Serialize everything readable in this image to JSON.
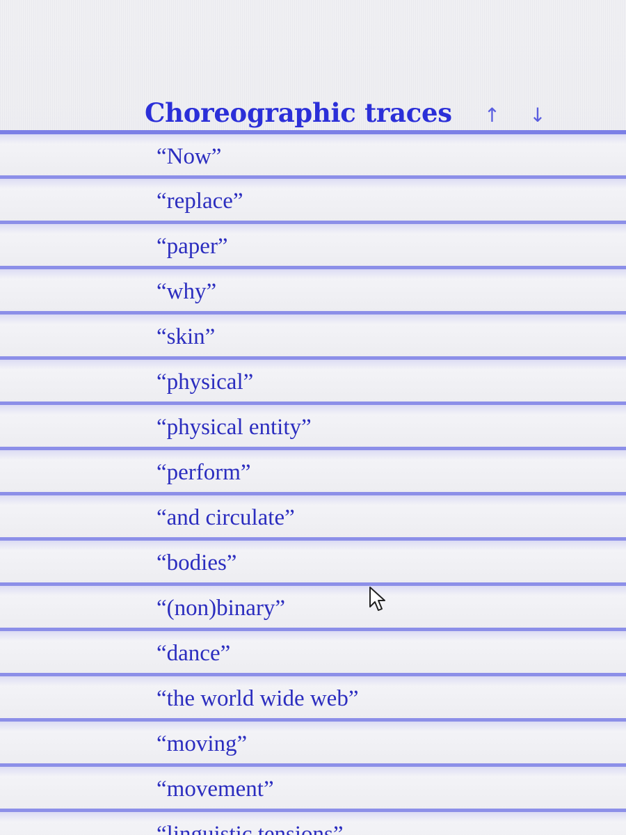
{
  "header": {
    "title": "Choreographic traces",
    "sort_up_icon": "arrow-up-icon",
    "sort_up_glyph": "↑",
    "sort_down_icon": "arrow-down-icon",
    "sort_down_glyph": "↓"
  },
  "items": [
    {
      "label": "“Now”"
    },
    {
      "label": "“replace”"
    },
    {
      "label": "“paper”"
    },
    {
      "label": "“why”"
    },
    {
      "label": "“skin”"
    },
    {
      "label": "“physical”"
    },
    {
      "label": "“physical entity”"
    },
    {
      "label": "“perform”"
    },
    {
      "label": "“and circulate”"
    },
    {
      "label": "“bodies”"
    },
    {
      "label": "“(non)binary”"
    },
    {
      "label": "“dance”"
    },
    {
      "label": "“the world wide web”"
    },
    {
      "label": "“moving”"
    },
    {
      "label": "“movement”"
    },
    {
      "label": "“linguistic tensions”"
    }
  ],
  "colors": {
    "title": "#2b2fd8",
    "item_text": "#2b2dbf",
    "row_divider": "#8c8fe8",
    "background": "#ececf1"
  },
  "pointer": {
    "icon": "mouse-cursor-icon"
  }
}
